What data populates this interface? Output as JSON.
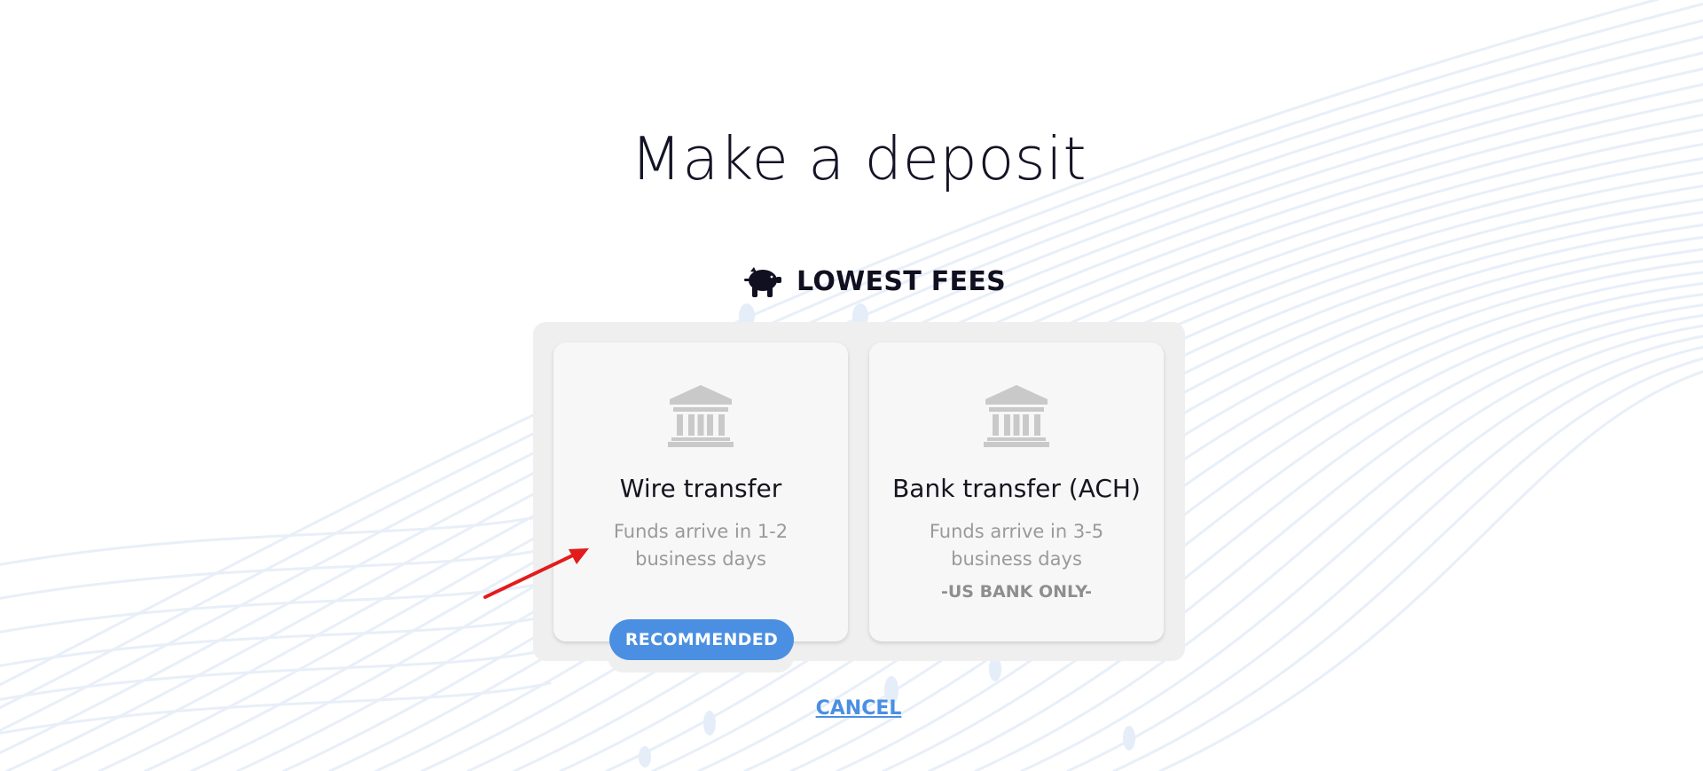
{
  "page": {
    "title": "Make a deposit"
  },
  "section": {
    "heading": "LOWEST FEES",
    "icon": "piggy-bank-icon"
  },
  "options": [
    {
      "title": "Wire transfer",
      "description": "Funds arrive in 1-2 business days",
      "note": "",
      "badge": "RECOMMENDED",
      "icon": "bank-icon"
    },
    {
      "title": "Bank transfer (ACH)",
      "description": "Funds arrive in 3-5 business days",
      "note": "-US BANK ONLY-",
      "badge": "",
      "icon": "bank-icon"
    }
  ],
  "actions": {
    "cancel_label": "CANCEL"
  },
  "colors": {
    "accent": "#4a8fe2",
    "title_text": "#141426",
    "muted_text": "#9a9a9a",
    "panel_bg": "#efefef",
    "card_bg": "#f7f7f7",
    "annotation_arrow": "#e31b1b"
  }
}
